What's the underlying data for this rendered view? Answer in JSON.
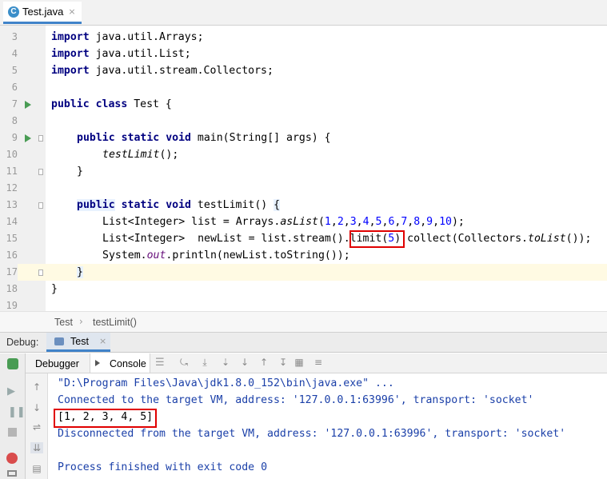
{
  "tab": {
    "icon_letter": "C",
    "file_name": "Test.java",
    "close": "×"
  },
  "editor": {
    "lines": [
      {
        "num": "3"
      },
      {
        "num": "4"
      },
      {
        "num": "5"
      },
      {
        "num": "6"
      },
      {
        "num": "7"
      },
      {
        "num": "8"
      },
      {
        "num": "9"
      },
      {
        "num": "10"
      },
      {
        "num": "11"
      },
      {
        "num": "12"
      },
      {
        "num": "13"
      },
      {
        "num": "14"
      },
      {
        "num": "15"
      },
      {
        "num": "16"
      },
      {
        "num": "17"
      },
      {
        "num": "18"
      },
      {
        "num": "19"
      }
    ],
    "tokens": {
      "import": "import",
      "arrays_pkg": " java.util.Arrays;",
      "list_pkg": " java.util.List;",
      "collectors_pkg": " java.util.stream.Collectors;",
      "public": "public",
      "class": "class",
      "class_name": " Test {",
      "static": "static",
      "void": "void",
      "main_sig": " main(String[] args) {",
      "call_test_limit": "testLimit",
      "call_end": "();",
      "close_brace": "}",
      "test_limit_sig": " testLimit() ",
      "open_brace": "{",
      "list_decl": "List<Integer> list = Arrays.",
      "as_list": "asList",
      "paren_open": "(",
      "nums": [
        "1",
        "2",
        "3",
        "4",
        "5",
        "6",
        "7",
        "8",
        "9",
        "10"
      ],
      "comma": ",",
      "paren_close_semi": ");",
      "newlist_decl": "List<Integer>  newList = list.stream().",
      "limit_call": "limit(",
      "limit_arg": "5",
      "limit_close": ")",
      "collect_call": ".collect(Collectors.",
      "to_list": "toList",
      "collect_end": "());",
      "print_prefix": "System.",
      "out": "out",
      "print_suffix": ".println(newList.toString());"
    }
  },
  "breadcrumb": {
    "items": [
      "Test",
      "testLimit()"
    ]
  },
  "debug": {
    "label": "Debug:",
    "run_tab": "Test",
    "tabs": {
      "debugger": "Debugger",
      "console": "Console"
    },
    "console_lines": [
      {
        "text": "\"D:\\Program Files\\Java\\jdk1.8.0_152\\bin\\java.exe\" ...",
        "color": "#1a3fa8"
      },
      {
        "text": "Connected to the target VM, address: '127.0.0.1:63996', transport: 'socket'",
        "color": "#1a3fa8"
      },
      {
        "text": "[1, 2, 3, 4, 5]",
        "color": "#000000"
      },
      {
        "text": "Disconnected from the target VM, address: '127.0.0.1:63996', transport: 'socket'",
        "color": "#1a3fa8"
      },
      {
        "text": "",
        "color": "#000000"
      },
      {
        "text": "Process finished with exit code 0",
        "color": "#1a3fa8"
      }
    ]
  },
  "colors": {
    "keyword": "#000080",
    "number": "#0000ff",
    "static_field": "#660e7a",
    "console_info": "#1a3fa8",
    "highlight_box": "#e00000",
    "run_icon": "#499c54",
    "tab_accent": "#4083c9"
  }
}
